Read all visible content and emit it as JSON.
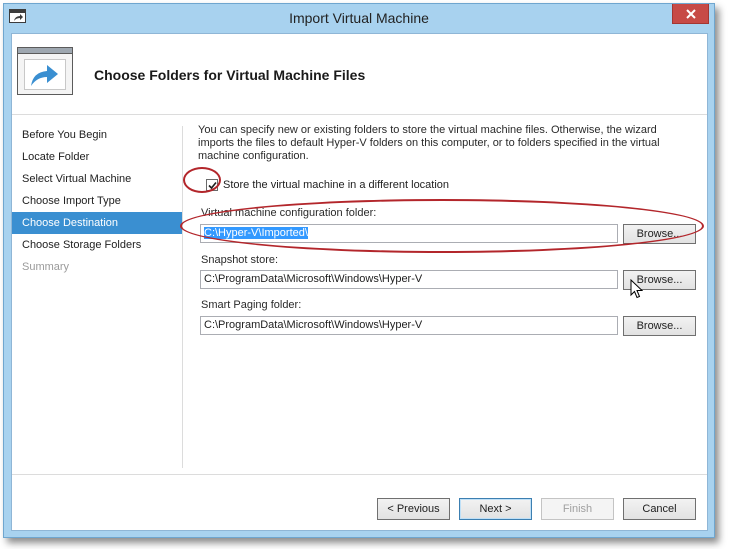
{
  "window": {
    "title": "Import Virtual Machine"
  },
  "header": {
    "title": "Choose Folders for Virtual Machine Files"
  },
  "nav": {
    "items": [
      {
        "label": "Before You Begin"
      },
      {
        "label": "Locate Folder"
      },
      {
        "label": "Select Virtual Machine"
      },
      {
        "label": "Choose Import Type"
      },
      {
        "label": "Choose Destination"
      },
      {
        "label": "Choose Storage Folders"
      },
      {
        "label": "Summary"
      }
    ],
    "active_index": 4,
    "disabled_index": 6
  },
  "content": {
    "description": "You can specify new or existing folders to store the virtual machine files. Otherwise, the wizard imports the files to default Hyper-V folders on this computer, or to folders specified in the virtual machine configuration.",
    "store_checkbox": {
      "label": "Store the virtual machine in a different location",
      "checked": true
    },
    "fields": [
      {
        "label": "Virtual machine configuration folder:",
        "value": "C:\\Hyper-V\\Imported\\",
        "browse_label": "Browse..."
      },
      {
        "label": "Snapshot store:",
        "value": "C:\\ProgramData\\Microsoft\\Windows\\Hyper-V",
        "browse_label": "Browse..."
      },
      {
        "label": "Smart Paging folder:",
        "value": "C:\\ProgramData\\Microsoft\\Windows\\Hyper-V",
        "browse_label": "Browse..."
      }
    ]
  },
  "footer": {
    "previous_label": "< Previous",
    "next_label": "Next >",
    "finish_label": "Finish",
    "cancel_label": "Cancel"
  },
  "colors": {
    "title_bar": "#a8d2ef",
    "close_button": "#c74a46",
    "nav_active": "#3a8fd1",
    "selection": "#3399ff",
    "annotation": "#b3262b"
  }
}
